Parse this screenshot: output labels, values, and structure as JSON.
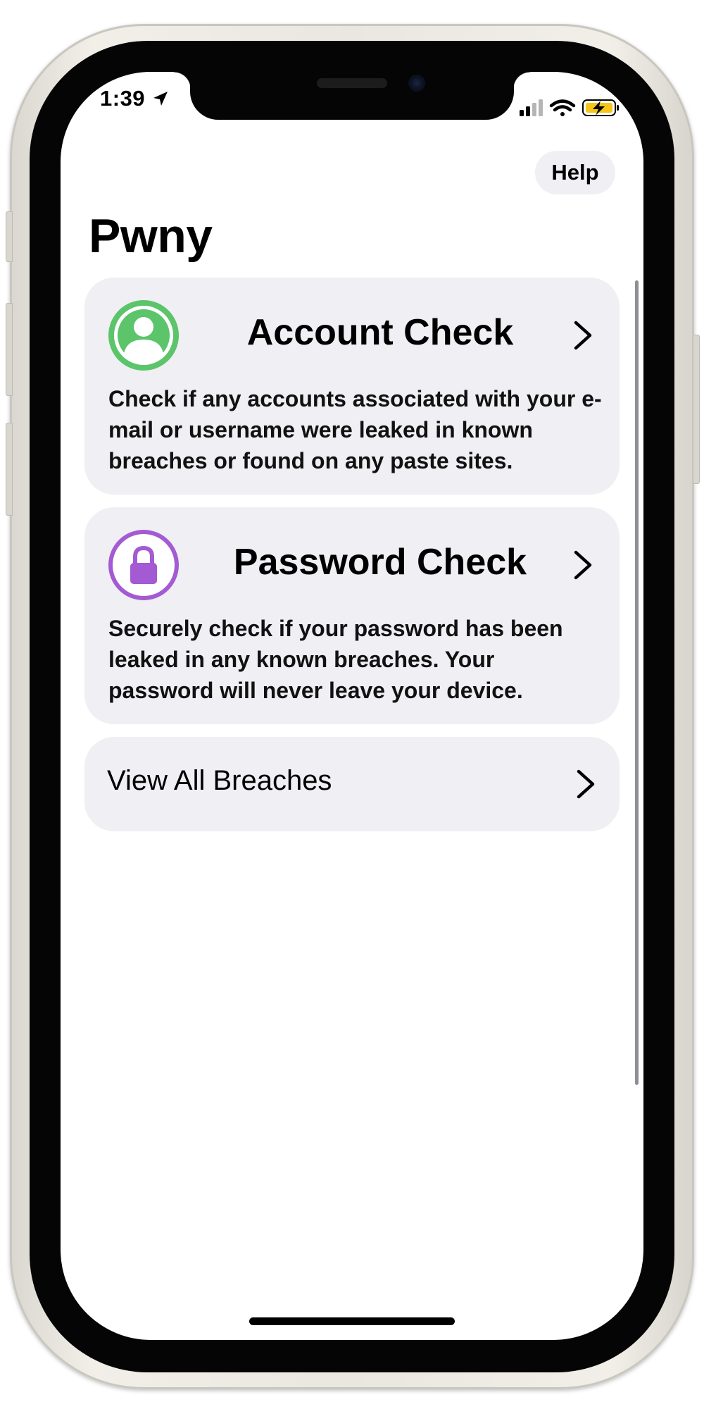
{
  "status_bar": {
    "time": "1:39"
  },
  "nav": {
    "help_label": "Help",
    "title": "Pwny"
  },
  "menu": {
    "account_check": {
      "title": "Account Check",
      "description": "Check if any accounts associated with your e-mail or username were leaked in known breaches or found on any paste sites.",
      "icon": "person-circle-icon",
      "accent": "#5cc46a"
    },
    "password_check": {
      "title": "Password Check",
      "description": "Securely check if your password has been leaked in any known breaches. Your password will never leave your device.",
      "icon": "lock-circle-icon",
      "accent": "#a35ad3"
    },
    "view_all_breaches": {
      "label": "View All Breaches"
    }
  },
  "colors": {
    "card_background": "#efeff4",
    "battery_charging": "#f5c518"
  }
}
